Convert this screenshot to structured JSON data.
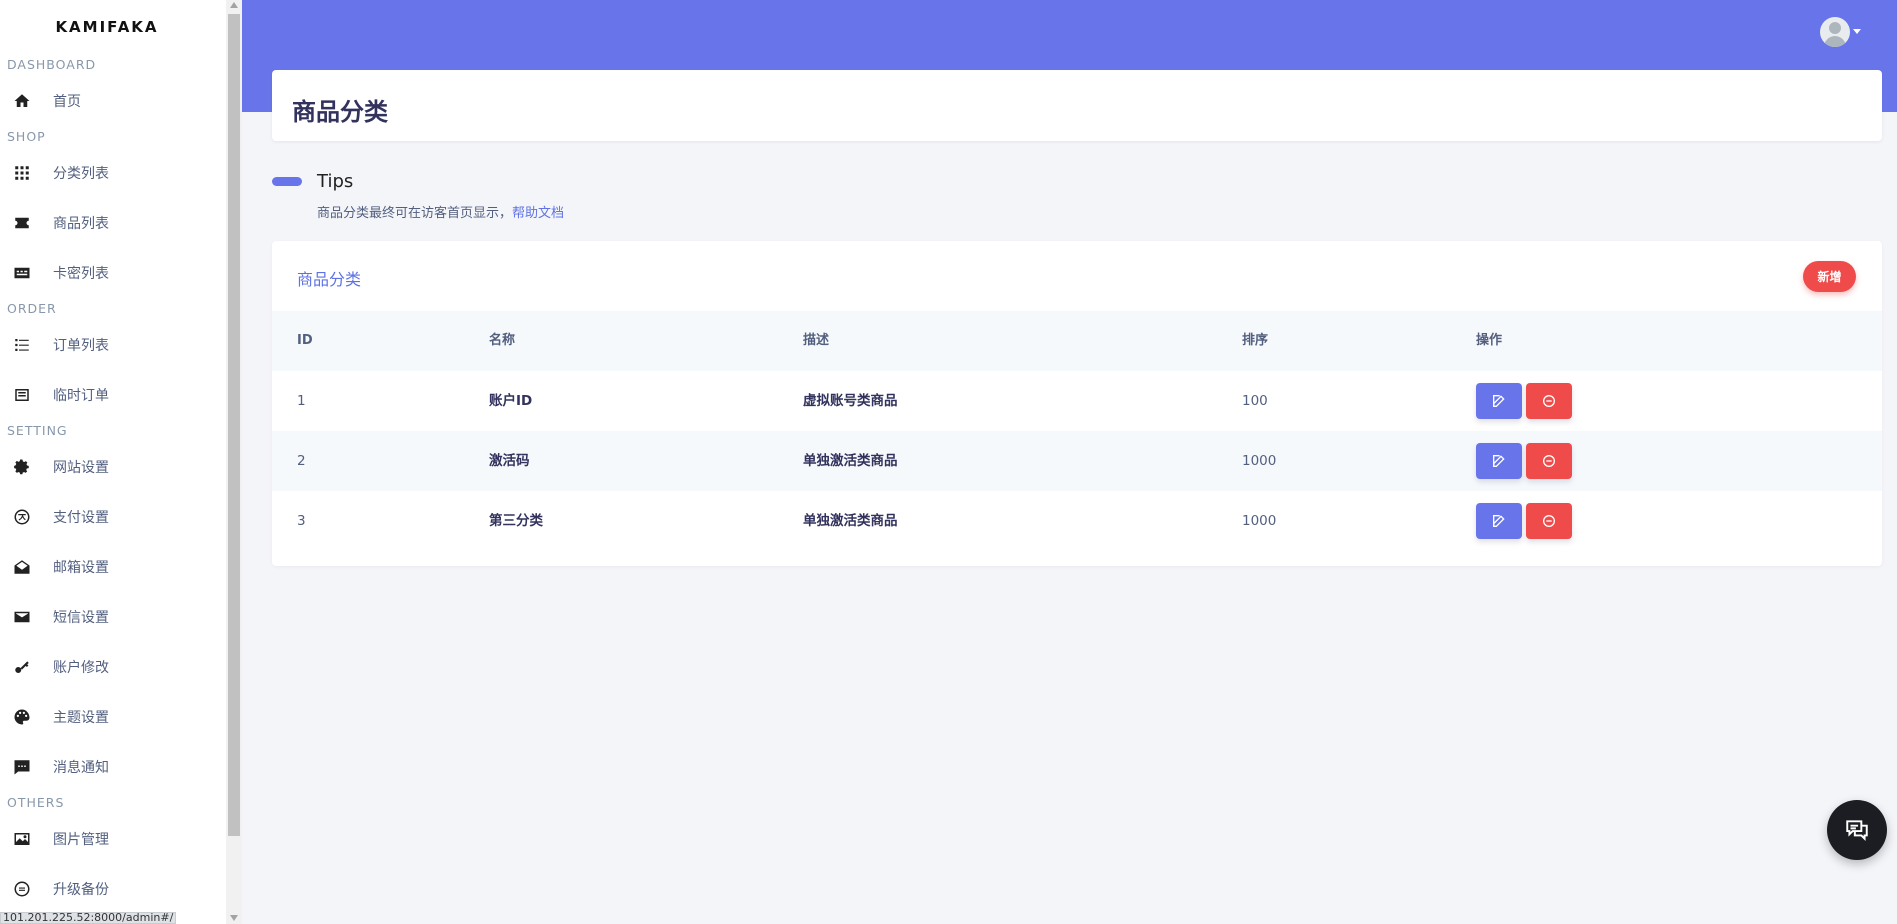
{
  "sidebar": {
    "brand": "KAMIFAKA",
    "sections": {
      "dashboard": "DASHBOARD",
      "shop": "SHOP",
      "order": "ORDER",
      "setting": "SETTING",
      "others": "OTHERS"
    },
    "items": {
      "home": "首页",
      "category_list": "分类列表",
      "product_list": "商品列表",
      "card_list": "卡密列表",
      "order_list": "订单列表",
      "temp_order": "临时订单",
      "site_settings": "网站设置",
      "payment_settings": "支付设置",
      "mail_settings": "邮箱设置",
      "sms_settings": "短信设置",
      "account_edit": "账户修改",
      "theme_settings": "主题设置",
      "notifications": "消息通知",
      "image_manage": "图片管理",
      "upgrade_backup": "升级备份"
    }
  },
  "status_url": "101.201.225.52:8000/admin#/",
  "header": {
    "page_title": "商品分类"
  },
  "tips": {
    "title": "Tips",
    "text": "商品分类最终可在访客首页显示，",
    "link": "帮助文档"
  },
  "table_card": {
    "title": "商品分类",
    "new_button": "新增",
    "columns": [
      "ID",
      "名称",
      "描述",
      "排序",
      "操作"
    ],
    "rows": [
      {
        "id": "1",
        "name": "账户ID",
        "desc": "虚拟账号类商品",
        "sort": "100"
      },
      {
        "id": "2",
        "name": "激活码",
        "desc": "单独激活类商品",
        "sort": "1000"
      },
      {
        "id": "3",
        "name": "第三分类",
        "desc": "单独激活类商品",
        "sort": "1000"
      }
    ]
  },
  "colors": {
    "primary": "#6875ea",
    "danger": "#ef4b4b",
    "link": "#5e72e4"
  },
  "icons": {
    "home": "home-icon",
    "category": "category-grid-icon",
    "product": "ticket-icon",
    "card": "card-icon",
    "orders": "list-icon",
    "temp_orders": "receipt-icon",
    "site": "gear-icon",
    "payment": "payment-icon",
    "mail": "envelope-open-icon",
    "sms": "envelope-icon",
    "account": "key-icon",
    "theme": "palette-icon",
    "notify": "message-icon",
    "image": "image-icon",
    "upgrade": "refresh-icon",
    "edit": "edit-icon",
    "delete": "minus-circle-icon",
    "chat": "chat-icon"
  }
}
